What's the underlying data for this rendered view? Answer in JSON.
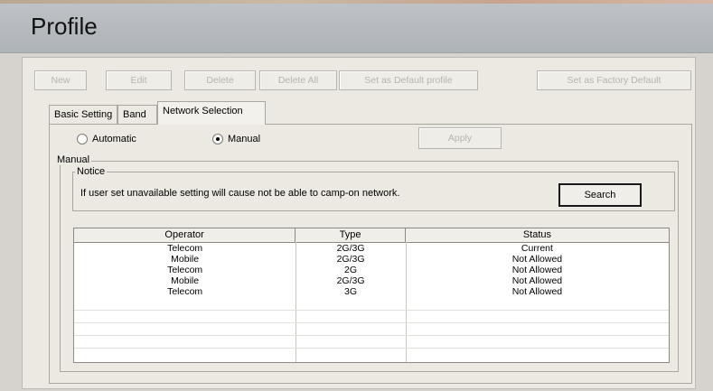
{
  "window": {
    "title": "Profile"
  },
  "toolbar": {
    "buttons": [
      "New",
      "Edit",
      "Delete",
      "Delete All",
      "Set as Default profile",
      "Set as Factory Default"
    ]
  },
  "tabs": [
    "Basic Setting",
    "Band",
    "Network Selection"
  ],
  "active_tab": "Network Selection",
  "mode": {
    "automatic_label": "Automatic",
    "manual_label": "Manual",
    "selected": "Manual"
  },
  "apply_label": "Apply",
  "manual_group": {
    "legend": "Manual",
    "notice_legend": "Notice",
    "notice_text": "If user set unavailable setting will cause  not be able to camp-on network.",
    "search_label": "Search"
  },
  "table": {
    "columns": [
      "Operator",
      "Type",
      "Status"
    ],
    "rows": [
      [
        "Telecom",
        "2G/3G",
        "Current"
      ],
      [
        "Mobile",
        "2G/3G",
        "Not Allowed"
      ],
      [
        "Telecom",
        "2G",
        "Not Allowed"
      ],
      [
        "Mobile",
        "2G/3G",
        "Not Allowed"
      ],
      [
        "Telecom",
        "3G",
        "Not Allowed"
      ]
    ]
  }
}
